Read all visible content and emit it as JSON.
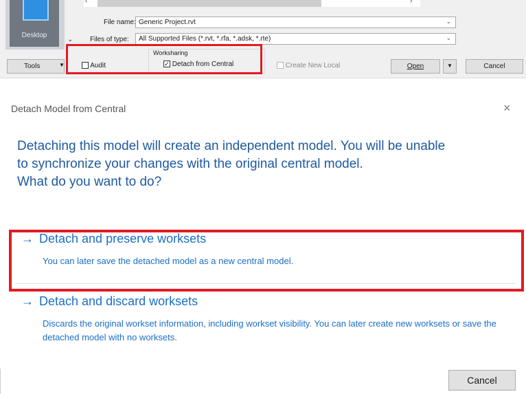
{
  "open_dialog": {
    "places": {
      "desktop_label": "Desktop"
    },
    "file_name": {
      "label": "File name:",
      "value": "Generic Project.rvt"
    },
    "files_of_type": {
      "label": "Files of type:",
      "value": "All Supported Files  (*.rvt, *.rfa, *.adsk, *.rte)"
    },
    "tools_label": "Tools",
    "audit_label": "Audit",
    "audit_checked": false,
    "worksharing": {
      "group_label": "Worksharing",
      "detach_label": "Detach from Central",
      "detach_checked": true,
      "create_local_label": "Create New Local",
      "create_local_checked": false
    },
    "open_label": "Open",
    "cancel_label": "Cancel",
    "icons": [
      "chevron-down-icon",
      "scroll-left-icon",
      "scroll-right-icon",
      "checkbox-icon"
    ]
  },
  "detach_dialog": {
    "title": "Detach Model from Central",
    "close_glyph": "×",
    "message_line1": "Detaching this model will create an independent model. You will be unable",
    "message_line2": "to synchronize your changes with the original central model.",
    "message_line3": "What do you want to do?",
    "options": [
      {
        "arrow": "→",
        "title": "Detach and preserve worksets",
        "description": "You can later save the detached model as a new central model."
      },
      {
        "arrow": "→",
        "title": "Detach and discard worksets",
        "description": "Discards the original workset information, including workset visibility. You can later create new worksets or save the detached model with no worksets."
      }
    ],
    "cancel_label": "Cancel"
  },
  "colors": {
    "highlight": "#e01b24",
    "link_blue": "#1a6fc4",
    "message_blue": "#1e5aa0"
  }
}
